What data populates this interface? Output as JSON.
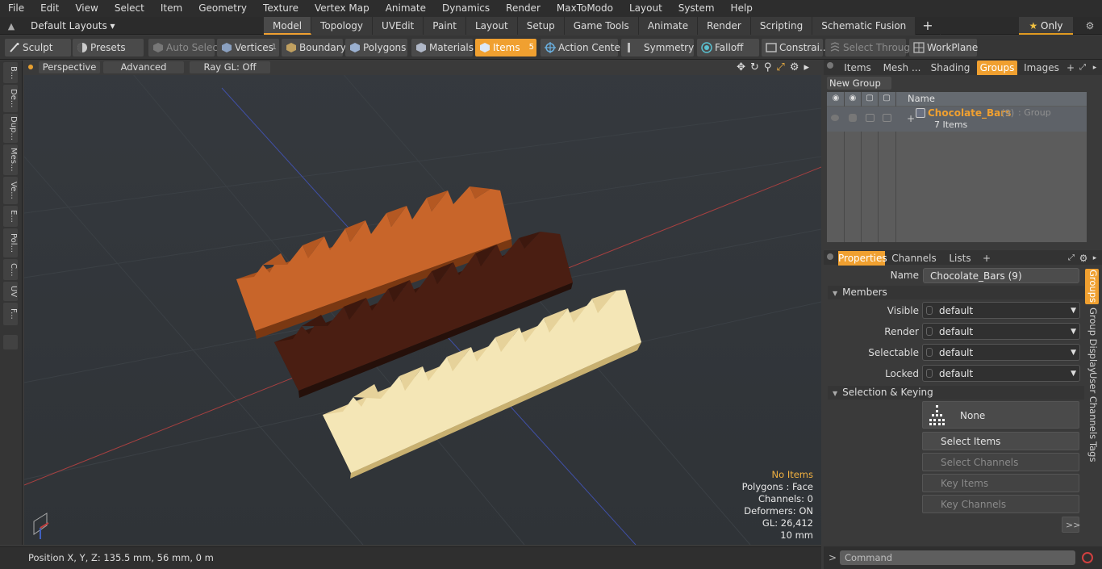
{
  "menu": [
    "File",
    "Edit",
    "View",
    "Select",
    "Item",
    "Geometry",
    "Texture",
    "Vertex Map",
    "Animate",
    "Dynamics",
    "Render",
    "MaxToModo",
    "Layout",
    "System",
    "Help"
  ],
  "layout_selector": "Default Layouts",
  "layout_tabs": [
    "Model",
    "Topology",
    "UVEdit",
    "Paint",
    "Layout",
    "Setup",
    "Game Tools",
    "Animate",
    "Render",
    "Scripting",
    "Schematic Fusion"
  ],
  "active_layout_tab": "Model",
  "only_label": "Only",
  "toolbar": {
    "sculpt": "Sculpt",
    "presets": "Presets",
    "auto_select": "Auto Select",
    "vertices": "Vertices",
    "vertices_count": "1",
    "boundary": "Boundary",
    "polygons": "Polygons",
    "materials": "Materials",
    "items": "Items",
    "items_count": "5",
    "action_center": "Action Center",
    "symmetry": "Symmetry",
    "falloff": "Falloff",
    "constraints": "Constrai...",
    "select_through": "Select Through",
    "workplane": "WorkPlane"
  },
  "left_strip": [
    "B...",
    "De...",
    "Dup...",
    "Mes...",
    "Ve...",
    "E...",
    "Pol...",
    "C...",
    "UV",
    "F..."
  ],
  "viewport": {
    "view_mode": "Perspective",
    "shading": "Advanced",
    "raygl": "Ray GL: Off",
    "info": {
      "items": "No Items",
      "polygons": "Polygons : Face",
      "channels": "Channels: 0",
      "deformers": "Deformers: ON",
      "gl": "GL: 26,412",
      "scale": "10 mm"
    }
  },
  "status": {
    "position": "Position X, Y, Z:   135.5 mm, 56 mm, 0 m"
  },
  "top_tabs": [
    "Items",
    "Mesh ...",
    "Shading",
    "Groups",
    "Images"
  ],
  "active_top_tab": "Groups",
  "groups": {
    "new_group": "New Group",
    "name_header": "Name",
    "entry_name": "Chocolate_Bars",
    "entry_count": "(9)",
    "entry_type": ": Group",
    "entry_items": "7 Items"
  },
  "prop_tabs": [
    "Properties",
    "Channels",
    "Lists"
  ],
  "properties": {
    "name_label": "Name",
    "name_value": "Chocolate_Bars (9)",
    "members_section": "Members",
    "fields": [
      {
        "label": "Visible",
        "value": "default"
      },
      {
        "label": "Render",
        "value": "default"
      },
      {
        "label": "Selectable",
        "value": "default"
      },
      {
        "label": "Locked",
        "value": "default"
      }
    ],
    "selection_section": "Selection & Keying",
    "none_button": "None",
    "select_items": "Select Items",
    "select_channels": "Select Channels",
    "key_items": "Key Items",
    "key_channels": "Key Channels",
    "more": ">>"
  },
  "side_tabs": [
    "Groups",
    "Group Display",
    "User Channels",
    "Tags"
  ],
  "command": {
    "prompt": ">",
    "placeholder": "Command"
  },
  "colors": {
    "accent": "#f0a030",
    "milk_chocolate": "#c8652a",
    "dark_chocolate": "#4a1e12",
    "white_chocolate": "#f4e6b6",
    "viewport_bg": "#313539"
  }
}
